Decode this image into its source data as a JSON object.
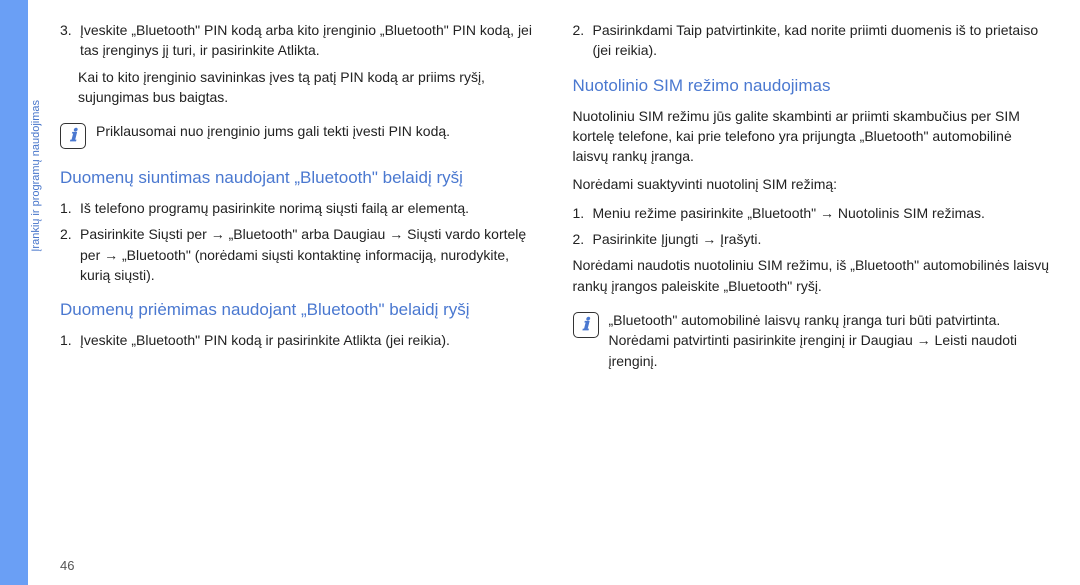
{
  "sidebar_label": "Įrankių ir programų naudojimas",
  "page_number": "46",
  "col1": {
    "item3_num": "3.",
    "item3_text": "Įveskite „Bluetooth\" PIN kodą arba kito įrenginio „Bluetooth\" PIN kodą, jei tas įrenginys jį turi, ir pasirinkite Atlikta.",
    "after3": "Kai to kito įrenginio savininkas įves tą patį PIN kodą ar priims ryšį, sujungimas bus baigtas.",
    "note1": "Priklausomai nuo įrenginio jums gali tekti įvesti PIN kodą.",
    "heading1": "Duomenų siuntimas naudojant „Bluetooth\" belaidį ryšį",
    "h1_i1_num": "1.",
    "h1_i1": "Iš telefono programų pasirinkite norimą siųsti failą ar elementą.",
    "h1_i2_num": "2.",
    "h1_i2": "Pasirinkite Siųsti per → „Bluetooth\" arba Daugiau → Siųsti vardo kortelę per → „Bluetooth\" (norėdami siųsti kontaktinę informaciją, nurodykite, kurią siųsti).",
    "heading2": "Duomenų priėmimas naudojant „Bluetooth\" belaidį ryšį",
    "h2_i1_num": "1.",
    "h2_i1": "Įveskite „Bluetooth\" PIN kodą ir pasirinkite Atlikta (jei reikia)."
  },
  "col2": {
    "i2_num": "2.",
    "i2": "Pasirinkdami Taip patvirtinkite, kad norite priimti duomenis iš to prietaiso (jei reikia).",
    "heading3": "Nuotolinio SIM režimo naudojimas",
    "p1": "Nuotoliniu SIM režimu jūs galite skambinti ar priimti skambučius per SIM kortelę telefone, kai prie telefono yra prijungta „Bluetooth\" automobilinė laisvų rankų įranga.",
    "p2": "Norėdami suaktyvinti nuotolinį SIM režimą:",
    "l1_num": "1.",
    "l1": "Meniu režime pasirinkite „Bluetooth\" → Nuotolinis SIM režimas.",
    "l2_num": "2.",
    "l2": "Pasirinkite Įjungti → Įrašyti.",
    "p3": "Norėdami naudotis nuotoliniu SIM režimu, iš „Bluetooth\" automobilinės laisvų rankų įrangos paleiskite „Bluetooth\" ryšį.",
    "note2": "„Bluetooth\" automobilinė laisvų rankų įranga turi būti patvirtinta. Norėdami patvirtinti pasirinkite įrenginį ir Daugiau → Leisti naudoti įrenginį."
  }
}
